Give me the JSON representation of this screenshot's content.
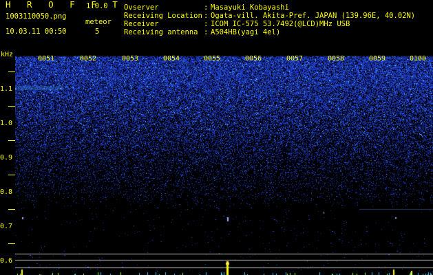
{
  "app": {
    "title": "H R O F F T",
    "version": "1.0.0"
  },
  "file": {
    "name": "1003110050.png",
    "datetime": "10.03.11 00:50"
  },
  "meteor": {
    "label": "meteor",
    "count": "5"
  },
  "info": [
    {
      "label": "Ovserver",
      "value": "Masayuki Kobayashi"
    },
    {
      "label": "Receiving Location",
      "value": "Ogata-vill. Akita-Pref. JAPAN (139.96E, 40.02N)"
    },
    {
      "label": "Receiver",
      "value": "ICOM IC-575 53.7492(@LCD)MHz USB"
    },
    {
      "label": "Receiving antenna",
      "value": "A504HB(yagi 4el)"
    }
  ],
  "axis": {
    "unit": "kHz",
    "y_ticks": [
      "1.1",
      "1.0",
      "0.9",
      "0.8",
      "0.7",
      "0.6"
    ],
    "x_ticks": [
      "0051",
      "0052",
      "0053",
      "0054",
      "0055",
      "0056",
      "0057",
      "0058",
      "0059",
      "0100"
    ]
  },
  "colors": {
    "text": "#ffff00",
    "background": "#000000",
    "noise": "#1e3cc8",
    "trail": "#ffff00",
    "grid": "#c8c8c8"
  }
}
